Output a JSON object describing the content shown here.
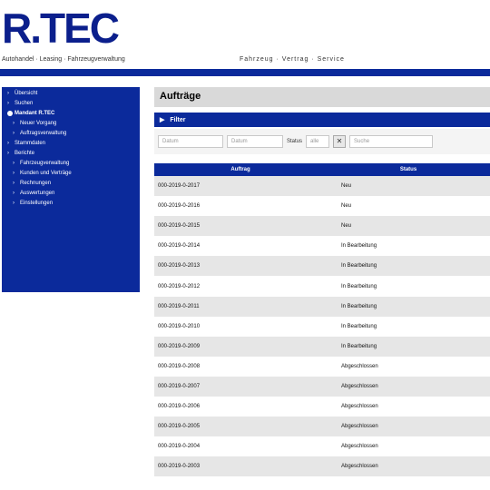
{
  "header": {
    "logo": "R.TEC",
    "sub_left": "Autohandel · Leasing · Fahrzeugverwaltung",
    "sub_right": "Fahrzeug · Vertrag · Service"
  },
  "sidebar": {
    "items": [
      {
        "label": "Übersicht",
        "bullet": "›",
        "indent": false,
        "active": false
      },
      {
        "label": "Suchen",
        "bullet": "›",
        "indent": false,
        "active": false
      },
      {
        "label": "Mandant R.TEC",
        "bullet": "circle",
        "indent": false,
        "active": true
      },
      {
        "label": "Neuer Vorgang",
        "bullet": "›",
        "indent": true,
        "active": false
      },
      {
        "label": "Auftragsverwaltung",
        "bullet": "›",
        "indent": true,
        "active": false
      },
      {
        "label": "Stammdaten",
        "bullet": "›",
        "indent": false,
        "active": false
      },
      {
        "label": "Berichte",
        "bullet": "›",
        "indent": false,
        "active": false
      },
      {
        "label": "Fahrzeugverwaltung",
        "bullet": "›",
        "indent": true,
        "active": false
      },
      {
        "label": "Kunden und Verträge",
        "bullet": "›",
        "indent": true,
        "active": false
      },
      {
        "label": "Rechnungen",
        "bullet": "›",
        "indent": true,
        "active": false
      },
      {
        "label": "Auswertungen",
        "bullet": "›",
        "indent": true,
        "active": false
      },
      {
        "label": "Einstellungen",
        "bullet": "›",
        "indent": true,
        "active": false
      }
    ]
  },
  "main": {
    "title": "Aufträge",
    "filter_title": "Filter",
    "filter": {
      "from_placeholder": "Datum",
      "to_placeholder": "Datum",
      "status_label": "Status",
      "status_value": "alle",
      "search_placeholder": "Suche",
      "close_btn": "✕"
    },
    "table": {
      "headers": [
        "Auftrag",
        "Status"
      ],
      "rows": [
        [
          "000-2019-0-2017",
          "Neu"
        ],
        [
          "000-2019-0-2016",
          "Neu"
        ],
        [
          "000-2019-0-2015",
          "Neu"
        ],
        [
          "000-2019-0-2014",
          "In Bearbeitung"
        ],
        [
          "000-2019-0-2013",
          "In Bearbeitung"
        ],
        [
          "000-2019-0-2012",
          "In Bearbeitung"
        ],
        [
          "000-2019-0-2011",
          "In Bearbeitung"
        ],
        [
          "000-2019-0-2010",
          "In Bearbeitung"
        ],
        [
          "000-2019-0-2009",
          "In Bearbeitung"
        ],
        [
          "000-2019-0-2008",
          "Abgeschlossen"
        ],
        [
          "000-2019-0-2007",
          "Abgeschlossen"
        ],
        [
          "000-2019-0-2006",
          "Abgeschlossen"
        ],
        [
          "000-2019-0-2005",
          "Abgeschlossen"
        ],
        [
          "000-2019-0-2004",
          "Abgeschlossen"
        ],
        [
          "000-2019-0-2003",
          "Abgeschlossen"
        ]
      ]
    }
  }
}
